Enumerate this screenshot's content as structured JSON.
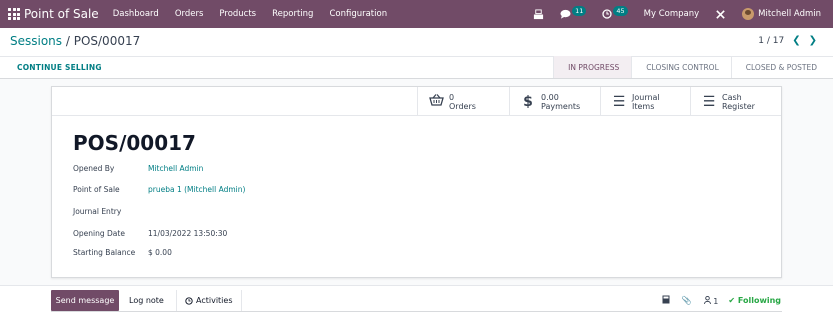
{
  "app": {
    "name": "Point of Sale"
  },
  "nav": [
    "Dashboard",
    "Orders",
    "Products",
    "Reporting",
    "Configuration"
  ],
  "topbar": {
    "messages_count": "11",
    "activities_count": "45",
    "company": "My Company",
    "user": "Mitchell Admin"
  },
  "breadcrumb": {
    "parent": "Sessions",
    "separator": " / ",
    "current": "POS/00017"
  },
  "pager": {
    "value": "1 / 17"
  },
  "actions": {
    "continue_selling": "CONTINUE SELLING"
  },
  "statusbar": [
    "IN PROGRESS",
    "CLOSING CONTROL",
    "CLOSED & POSTED"
  ],
  "smart_buttons": {
    "orders": {
      "value": "0",
      "label": "Orders"
    },
    "payments": {
      "value": "0.00",
      "label": "Payments"
    },
    "journal_items": {
      "line1": "Journal",
      "line2": "Items"
    },
    "cash_register": {
      "line1": "Cash",
      "line2": "Register"
    }
  },
  "record": {
    "title": "POS/00017",
    "fields": {
      "opened_by": {
        "label": "Opened By",
        "value": "Mitchell Admin"
      },
      "point_of_sale": {
        "label": "Point of Sale",
        "value": "prueba 1 (Mitchell Admin)"
      },
      "journal_entry": {
        "label": "Journal Entry",
        "value": ""
      },
      "opening_date": {
        "label": "Opening Date",
        "value": "11/03/2022 13:50:30"
      },
      "starting_balance": {
        "label": "Starting Balance",
        "value": "$ 0.00"
      }
    }
  },
  "chatter": {
    "send_message": "Send message",
    "log_note": "Log note",
    "activities": "Activities",
    "followers_count": "1",
    "following": "Following"
  },
  "colors": {
    "brand": "#714b67",
    "link": "#017e84",
    "following": "#28a745"
  }
}
